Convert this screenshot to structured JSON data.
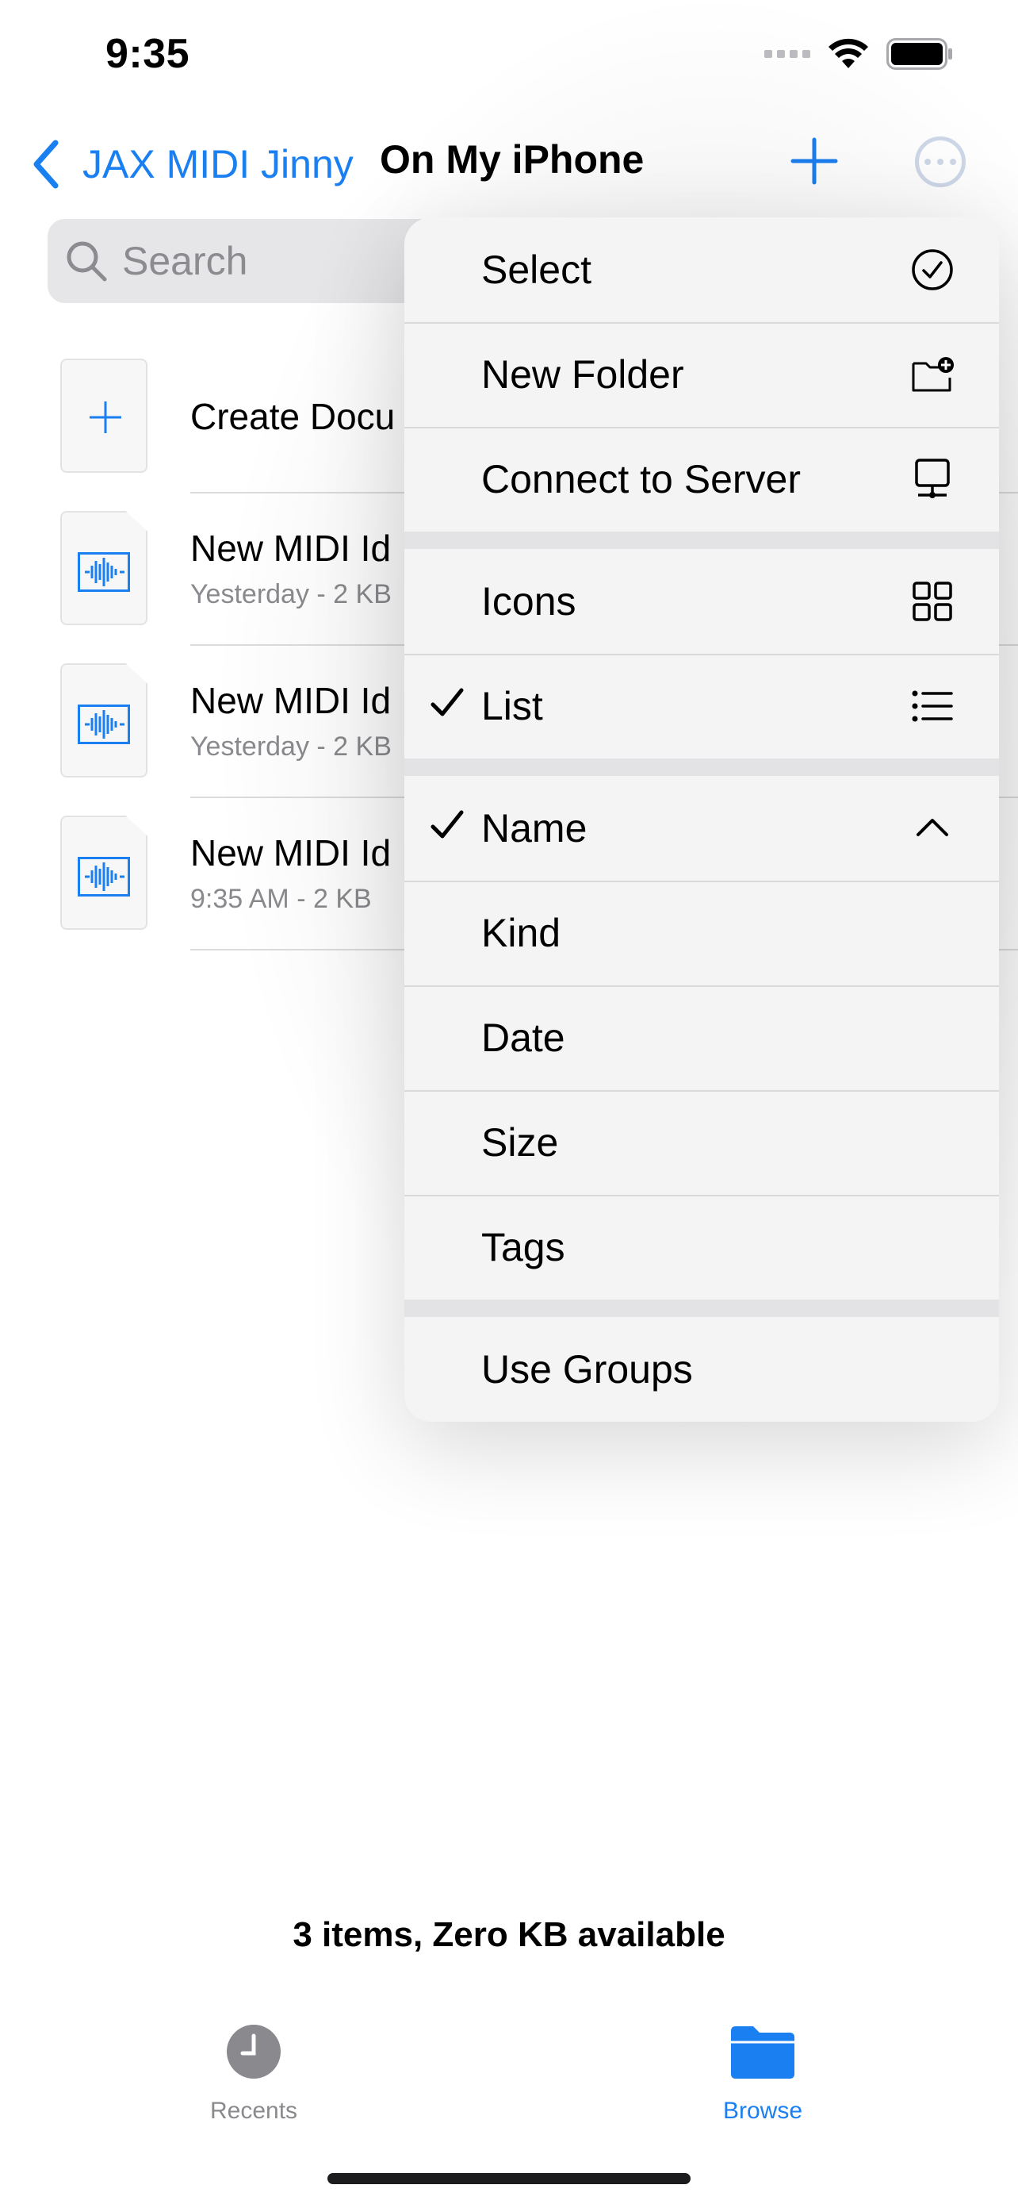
{
  "status": {
    "time": "9:35"
  },
  "nav": {
    "back_label": "JAX MIDI Jinny",
    "title": "On My iPhone"
  },
  "search": {
    "placeholder": "Search"
  },
  "files": [
    {
      "title": "Create Docu",
      "subtitle": ""
    },
    {
      "title": "New MIDI Id",
      "subtitle": "Yesterday - 2 KB"
    },
    {
      "title": "New MIDI Id",
      "subtitle": "Yesterday - 2 KB"
    },
    {
      "title": "New MIDI Id",
      "subtitle": "9:35 AM - 2 KB"
    }
  ],
  "menu": {
    "group1": [
      {
        "label": "Select",
        "icon": "checkmark-circle-icon"
      },
      {
        "label": "New Folder",
        "icon": "folder-plus-icon"
      },
      {
        "label": "Connect to Server",
        "icon": "desktop-computer-icon"
      }
    ],
    "group2": [
      {
        "label": "Icons",
        "icon": "grid-icon",
        "checked": false
      },
      {
        "label": "List",
        "icon": "list-icon",
        "checked": true
      }
    ],
    "group3": [
      {
        "label": "Name",
        "icon": "chevron-up-icon",
        "checked": true
      },
      {
        "label": "Kind"
      },
      {
        "label": "Date"
      },
      {
        "label": "Size"
      },
      {
        "label": "Tags"
      }
    ],
    "group4": [
      {
        "label": "Use Groups"
      }
    ]
  },
  "footer": {
    "summary": "3 items, Zero KB available"
  },
  "tabs": [
    {
      "label": "Recents",
      "icon": "clock-icon",
      "active": false
    },
    {
      "label": "Browse",
      "icon": "folder-icon",
      "active": true
    }
  ],
  "colors": {
    "accent": "#1a7ff0",
    "inactive": "#8a8a8e",
    "menu_bg": "#f4f4f4"
  }
}
